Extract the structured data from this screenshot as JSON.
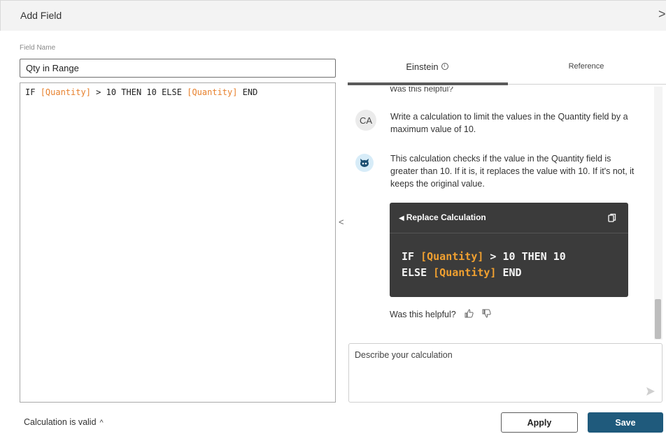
{
  "dialog": {
    "title": "Add Field",
    "close_glyph": ">"
  },
  "field": {
    "label": "Field Name",
    "value": "Qty in Range"
  },
  "editor": {
    "tokens": [
      {
        "text": "IF ",
        "type": "keyword"
      },
      {
        "text": "[Quantity]",
        "type": "field"
      },
      {
        "text": " > 10 THEN 10 ELSE ",
        "type": "keyword"
      },
      {
        "text": "[Quantity]",
        "type": "field"
      },
      {
        "text": " END",
        "type": "keyword"
      }
    ]
  },
  "panel": {
    "collapse_glyph": "<",
    "tabs": [
      {
        "label": "Einstein",
        "active": true,
        "icon": "info-icon"
      },
      {
        "label": "Reference",
        "active": false
      }
    ]
  },
  "chat": {
    "faded_text": "Was this helpful?",
    "user": {
      "initials": "CA",
      "message": "Write a calculation to limit the values in the Quantity field by a maximum value of 10."
    },
    "bot": {
      "icon": "einstein-bot-icon",
      "message": "This calculation checks if the value in the Quantity field is greater than 10. If it is, it replaces the value with 10. If it's not, it keeps the original value."
    },
    "code_card": {
      "replace_label": "Replace Calculation",
      "replace_glyph": "◀",
      "line1_tokens": [
        {
          "text": "IF ",
          "type": "keyword"
        },
        {
          "text": "[Quantity]",
          "type": "field"
        },
        {
          "text": " > 10 THEN 10",
          "type": "keyword"
        }
      ],
      "line2_tokens": [
        {
          "text": "ELSE ",
          "type": "keyword"
        },
        {
          "text": "[Quantity]",
          "type": "field"
        },
        {
          "text": " END",
          "type": "keyword"
        }
      ]
    },
    "helpful_label": "Was this helpful?"
  },
  "prompt": {
    "placeholder": "Describe your calculation"
  },
  "footer": {
    "status": "Calculation is valid",
    "status_glyph": "^",
    "apply_label": "Apply",
    "save_label": "Save"
  },
  "colors": {
    "accent": "#1f5a7c",
    "field_token": "#e8812d",
    "code_card_bg": "#3b3b3b"
  }
}
